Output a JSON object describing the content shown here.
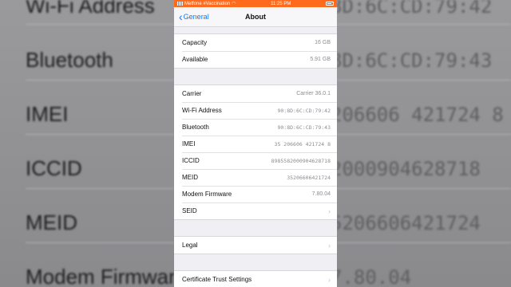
{
  "background": {
    "left_rows": [
      "Wi-Fi Address",
      "Bluetooth",
      "IMEI",
      "ICCID",
      "MEID",
      "Modem Firmwar"
    ],
    "right_rows": [
      "8D:6C:CD:79:42",
      "8D:6C:CD:79:43",
      "206606 421724 8",
      "2000904628718",
      "5206606421724",
      "7.80.04"
    ]
  },
  "status_bar": {
    "carrier": "Metfone #Vaccination",
    "time": "11:25 PM"
  },
  "nav": {
    "back_label": "General",
    "title": "About"
  },
  "groups": [
    [
      {
        "label": "Capacity",
        "value": "16 GB"
      },
      {
        "label": "Available",
        "value": "5.91 GB"
      }
    ],
    [
      {
        "label": "Carrier",
        "value": "Carrier 36.0.1"
      },
      {
        "label": "Wi-Fi Address",
        "value": "90:8D:6C:CD:79:42"
      },
      {
        "label": "Bluetooth",
        "value": "90:8D:6C:CD:79:43"
      },
      {
        "label": "IMEI",
        "value": "35 206606 421724 8"
      },
      {
        "label": "ICCID",
        "value": "8985582000904628718"
      },
      {
        "label": "MEID",
        "value": "35206606421724"
      },
      {
        "label": "Modem Firmware",
        "value": "7.80.04"
      },
      {
        "label": "SEID",
        "value": ""
      }
    ],
    [
      {
        "label": "Legal",
        "value": ""
      }
    ],
    [
      {
        "label": "Certificate Trust Settings",
        "value": ""
      }
    ]
  ],
  "colors": {
    "status_bar": "#ff6a1c",
    "link": "#0a78ff"
  }
}
